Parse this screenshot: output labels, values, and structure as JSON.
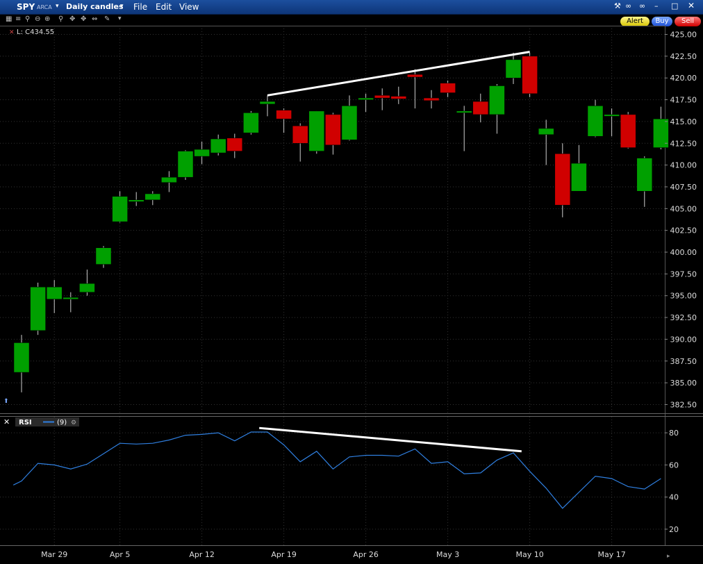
{
  "window": {
    "symbol": "SPY",
    "exchange": "ARCA",
    "chart_mode": "Daily candles",
    "menu": [
      "File",
      "Edit",
      "View"
    ],
    "buttons": {
      "alert": "Alert",
      "buy": "Buy",
      "sell": "Sell"
    },
    "last_label": "L: C434.55"
  },
  "rsi_panel": {
    "label": "RSI",
    "period": "(9)"
  },
  "colors": {
    "up": "#00a000",
    "down": "#d00000",
    "rsi_line": "#2f7fe0",
    "trend_line": "#ffffff",
    "title_bar": "#1c4f9e"
  },
  "chart_data": [
    {
      "type": "candlestick",
      "title": "",
      "ylim": [
        381.5,
        426.0
      ],
      "yticks": [
        425.0,
        422.5,
        420.0,
        417.5,
        415.0,
        412.5,
        410.0,
        407.5,
        405.0,
        402.5,
        400.0,
        397.5,
        395.0,
        392.5,
        390.0,
        387.5,
        385.0,
        382.5
      ],
      "x_tick_labels": [
        {
          "label": "Mar 29",
          "index": 2
        },
        {
          "label": "Apr 5",
          "index": 6
        },
        {
          "label": "Apr 12",
          "index": 11
        },
        {
          "label": "Apr 19",
          "index": 16
        },
        {
          "label": "Apr 26",
          "index": 21
        },
        {
          "label": "May 3",
          "index": 26
        },
        {
          "label": "May 10",
          "index": 31
        },
        {
          "label": "May 17",
          "index": 36
        }
      ],
      "candles": [
        {
          "o": 386.2,
          "h": 390.5,
          "l": 383.9,
          "c": 389.6
        },
        {
          "o": 391.0,
          "h": 396.5,
          "l": 390.5,
          "c": 396.0
        },
        {
          "o": 394.6,
          "h": 396.8,
          "l": 393.0,
          "c": 396.0
        },
        {
          "o": 394.6,
          "h": 395.4,
          "l": 393.1,
          "c": 394.8
        },
        {
          "o": 395.4,
          "h": 398.0,
          "l": 395.0,
          "c": 396.4
        },
        {
          "o": 398.6,
          "h": 400.7,
          "l": 398.2,
          "c": 400.5
        },
        {
          "o": 403.5,
          "h": 407.0,
          "l": 403.4,
          "c": 406.4
        },
        {
          "o": 405.8,
          "h": 406.9,
          "l": 405.3,
          "c": 406.0
        },
        {
          "o": 406.0,
          "h": 407.0,
          "l": 405.4,
          "c": 406.7
        },
        {
          "o": 408.0,
          "h": 409.3,
          "l": 406.9,
          "c": 408.6
        },
        {
          "o": 408.6,
          "h": 411.7,
          "l": 408.3,
          "c": 411.6
        },
        {
          "o": 411.0,
          "h": 412.7,
          "l": 410.1,
          "c": 411.8
        },
        {
          "o": 411.4,
          "h": 413.5,
          "l": 411.1,
          "c": 413.0
        },
        {
          "o": 413.1,
          "h": 413.6,
          "l": 410.8,
          "c": 411.6
        },
        {
          "o": 413.7,
          "h": 416.2,
          "l": 413.5,
          "c": 416.0
        },
        {
          "o": 417.0,
          "h": 418.0,
          "l": 415.6,
          "c": 417.3
        },
        {
          "o": 416.3,
          "h": 416.5,
          "l": 413.7,
          "c": 415.3
        },
        {
          "o": 414.5,
          "h": 414.8,
          "l": 410.4,
          "c": 412.5
        },
        {
          "o": 411.6,
          "h": 416.2,
          "l": 411.3,
          "c": 416.2
        },
        {
          "o": 415.8,
          "h": 416.0,
          "l": 411.2,
          "c": 412.3
        },
        {
          "o": 412.9,
          "h": 418.0,
          "l": 412.8,
          "c": 416.8
        },
        {
          "o": 417.5,
          "h": 418.2,
          "l": 416.1,
          "c": 417.7
        },
        {
          "o": 418.0,
          "h": 418.8,
          "l": 416.3,
          "c": 417.7
        },
        {
          "o": 417.9,
          "h": 419.0,
          "l": 417.0,
          "c": 417.6
        },
        {
          "o": 420.4,
          "h": 421.0,
          "l": 416.5,
          "c": 420.1
        },
        {
          "o": 417.7,
          "h": 418.6,
          "l": 416.5,
          "c": 417.4
        },
        {
          "o": 419.4,
          "h": 419.7,
          "l": 417.8,
          "c": 418.3
        },
        {
          "o": 416.0,
          "h": 416.8,
          "l": 411.6,
          "c": 416.2
        },
        {
          "o": 417.3,
          "h": 418.2,
          "l": 414.9,
          "c": 415.8
        },
        {
          "o": 415.8,
          "h": 419.3,
          "l": 413.6,
          "c": 419.1
        },
        {
          "o": 420.0,
          "h": 422.9,
          "l": 419.3,
          "c": 422.1
        },
        {
          "o": 422.5,
          "h": 422.9,
          "l": 417.8,
          "c": 418.2
        },
        {
          "o": 413.5,
          "h": 415.2,
          "l": 410.0,
          "c": 414.2
        },
        {
          "o": 411.3,
          "h": 412.5,
          "l": 404.0,
          "c": 405.4
        },
        {
          "o": 407.0,
          "h": 412.3,
          "l": 407.0,
          "c": 410.2
        },
        {
          "o": 413.3,
          "h": 417.5,
          "l": 413.2,
          "c": 416.8
        },
        {
          "o": 415.6,
          "h": 416.5,
          "l": 413.3,
          "c": 415.8
        },
        {
          "o": 415.8,
          "h": 416.1,
          "l": 411.9,
          "c": 412.0
        },
        {
          "o": 407.0,
          "h": 411.0,
          "l": 405.2,
          "c": 410.8
        },
        {
          "o": 412.0,
          "h": 416.7,
          "l": 411.8,
          "c": 415.3
        }
      ],
      "trend_line": [
        {
          "index": 15,
          "value": 418.0
        },
        {
          "index": 31,
          "value": 423.0
        }
      ]
    },
    {
      "type": "line",
      "title": "",
      "ylim": [
        10,
        90
      ],
      "yticks": [
        80,
        60,
        40,
        20
      ],
      "x": [
        -0.5,
        0,
        1,
        2,
        3,
        4,
        5,
        6,
        7,
        8,
        9,
        10,
        11,
        12,
        13,
        14,
        15,
        16,
        17,
        18,
        19,
        20,
        21,
        22,
        23,
        24,
        25,
        26,
        27,
        28,
        29,
        30,
        31,
        32,
        33,
        34,
        35,
        36,
        37,
        38,
        39
      ],
      "series": [
        {
          "values": [
            47.5,
            50,
            61,
            60,
            57.5,
            60.5,
            67,
            73.5,
            73,
            73.5,
            75.5,
            78.5,
            79,
            80,
            75,
            80.5,
            80.5,
            72.5,
            62,
            68.5,
            57.5,
            65,
            66,
            66,
            65.5,
            70,
            61,
            62,
            54.5,
            55,
            63,
            67.5,
            56,
            45.5,
            33,
            43,
            53,
            51.5,
            46.5,
            45,
            51.5
          ]
        }
      ],
      "trend_line": [
        {
          "index": 14.5,
          "value": 83
        },
        {
          "index": 30.5,
          "value": 68.5
        }
      ]
    }
  ]
}
